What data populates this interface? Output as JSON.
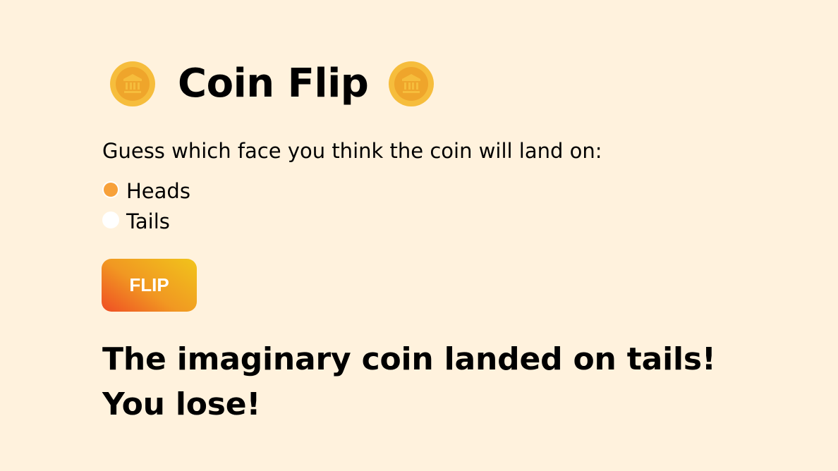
{
  "app": {
    "title": "Coin Flip"
  },
  "icons": {
    "left_coin": "bank-coin-icon",
    "right_coin": "bank-coin-icon"
  },
  "form": {
    "prompt": "Guess which face you think the coin will land on:",
    "options": [
      {
        "label": "Heads",
        "checked": true
      },
      {
        "label": "Tails",
        "checked": false
      }
    ],
    "button_label": "FLIP"
  },
  "result": {
    "line1": "The imaginary coin landed on tails!",
    "line2": "You lose!"
  },
  "colors": {
    "background": "#fff2dd",
    "coin_outer": "#f6bd3c",
    "coin_inner": "#efa52b",
    "radio_selected": "#f7a13a",
    "button_gradient_start": "#ef4d24",
    "button_gradient_end": "#f1c41b"
  }
}
